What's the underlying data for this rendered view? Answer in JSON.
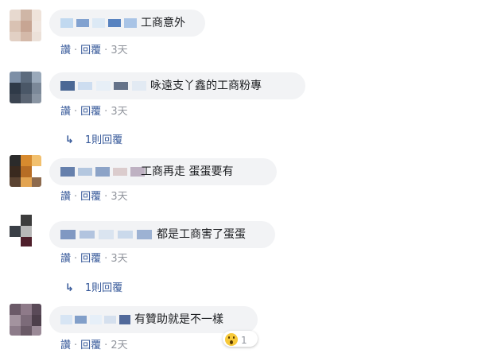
{
  "comments": [
    {
      "text": "工商意外",
      "actions": {
        "like": "讚",
        "reply": "回覆",
        "time": "3天"
      },
      "avatar_colors": [
        "#e7d9cf",
        "#cfb6a6",
        "#efe3da",
        "#d9c2b3",
        "#c7a593",
        "#f0e6df",
        "#e2d0c4",
        "#d4b9a9",
        "#ece1d9"
      ],
      "mosaic_colors": [
        "#b9d3ef",
        "#6e93c9",
        "#d8e6f4",
        "#3d6fb6",
        "#9cbbe3"
      ]
    },
    {
      "text": "咏遠支丫鑫的工商粉專",
      "actions": {
        "like": "讚",
        "reply": "回覆",
        "time": "3天"
      },
      "replies_label": "1則回覆",
      "avatar_colors": [
        "#7d8fa6",
        "#5c6b7d",
        "#9aa9ba",
        "#2f3a48",
        "#4a5767",
        "#7b8898",
        "#3b4451",
        "#5b6573",
        "#8a95a3"
      ],
      "mosaic_colors": [
        "#2e4f84",
        "#c7d8ee",
        "#e5edf7",
        "#4d5c75",
        "#dfe7f2"
      ]
    },
    {
      "text": "工商再走 蛋蛋要有",
      "actions": {
        "like": "讚",
        "reply": "回覆",
        "time": "3天"
      },
      "avatar_colors": [
        "#2b2b2b",
        "#d78a2e",
        "#f2c06e",
        "#3a2a1f",
        "#b76d25",
        "#ffffff",
        "#5a4331",
        "#e3a451",
        "#8d6a4d"
      ],
      "mosaic_colors": [
        "#4d6b9f",
        "#a9bedb",
        "#7a94be",
        "#d7c4c6",
        "#b5a4b8"
      ]
    },
    {
      "text": "都是工商害了蛋蛋",
      "actions": {
        "like": "讚",
        "reply": "回覆",
        "time": "3天"
      },
      "replies_label": "1則回覆",
      "avatar_colors": [
        "#ffffff",
        "#3d3d3d",
        "#ffffff",
        "#3a3f46",
        "#b8b8b8",
        "#ffffff",
        "#ffffff",
        "#4e1f2b",
        "#ffffff"
      ],
      "mosaic_colors": [
        "#6c87b8",
        "#a7bbdb",
        "#d6e1ef",
        "#c3d3e9",
        "#8ea6cc"
      ]
    },
    {
      "text": "有贊助就是不一樣",
      "actions": {
        "like": "讚",
        "reply": "回覆",
        "time": "2天"
      },
      "reaction": {
        "count": "1"
      },
      "avatar_colors": [
        "#6b5a68",
        "#8e7a89",
        "#5a4a58",
        "#a3939f",
        "#7c6b79",
        "#4d3f4b",
        "#8d7c8a",
        "#6a5a67",
        "#9b8a97"
      ],
      "mosaic_colors": [
        "#d2e2f3",
        "#6f8fc1",
        "#e4edf8",
        "#d0dcec",
        "#35508a"
      ]
    }
  ]
}
